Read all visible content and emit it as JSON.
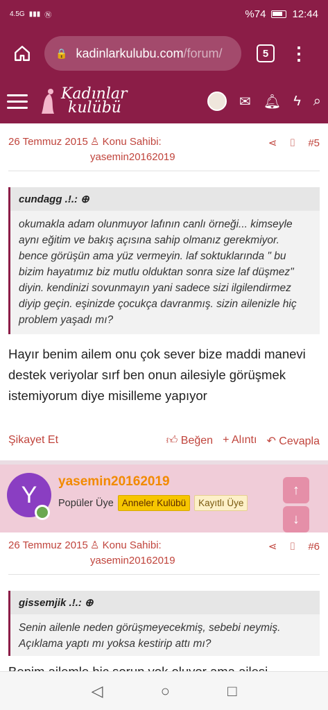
{
  "status": {
    "network": "4.5G",
    "battery": "%74",
    "time": "12:44"
  },
  "browser": {
    "url_main": "kadinlarkulubu.com",
    "url_path": "/forum/",
    "tab_count": "5"
  },
  "site": {
    "logo_line1": "Kadınlar",
    "logo_line2": "kulübü"
  },
  "post1": {
    "date": "26 Temmuz 2015",
    "owner_label": "Konu Sahibi:",
    "owner_name": "yasemin20162019",
    "number": "#5",
    "quote_author": "cundagg .!.:",
    "quote_text": "okumakla adam olunmuyor lafının canlı örneği... kimseyle aynı eğitim ve bakış açısına sahip olmanız gerekmiyor. bence görüşün ama yüz vermeyin. laf soktuklarında \" bu bizim hayatımız biz mutlu olduktan sonra size laf düşmez\" diyin. kendinizi sovunmayın yani sadece sizi ilgilendirmez diyip geçin. eşinizde çocukça davranmış. sizin ailenizle hiç problem yaşadı mı?",
    "body": "Hayır benim ailem onu çok sever bize maddi manevi destek veriyolar sırf ben onun ailesiyle görüşmek istemiyorum diye misilleme yapıyor",
    "report": "Şikayet Et",
    "like": "Beğen",
    "quote_action": "Alıntı",
    "reply": "Cevapla"
  },
  "user2": {
    "initial": "Y",
    "name": "yasemin20162019",
    "title": "Popüler Üye",
    "badge_club": "Anneler Kulübü",
    "badge_registered": "Kayıtlı Üye"
  },
  "post2": {
    "date": "26 Temmuz 2015",
    "owner_label": "Konu Sahibi:",
    "owner_name": "yasemin20162019",
    "number": "#6",
    "quote_author": "gissemjik .!.:",
    "quote_text": "Senin ailenle neden görüşmeyecekmiş, sebebi neymiş. Açıklama yaptı mı yoksa kestirip attı mı?",
    "body_peek": "Benim ailemle hiç sorun yok oluyor ama ailesi"
  },
  "colors": {
    "brand": "#8b1d47",
    "accent_text": "#c0443c",
    "username": "#f28a00"
  }
}
